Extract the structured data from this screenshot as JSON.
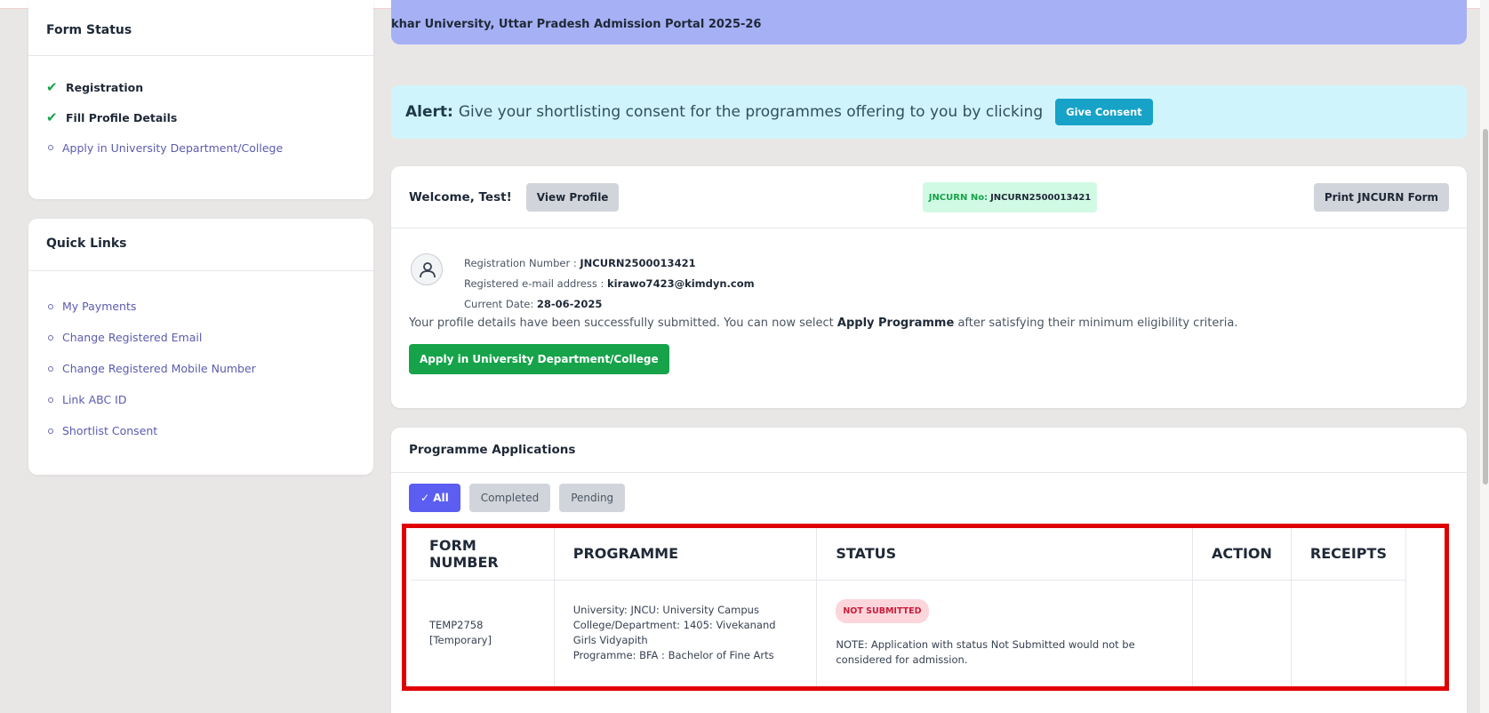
{
  "banner": {
    "text": "khar University, Uttar Pradesh Admission Portal 2025-26"
  },
  "form_status": {
    "title": "Form Status",
    "items": [
      {
        "label": "Registration",
        "state": "done"
      },
      {
        "label": "Fill Profile Details",
        "state": "done"
      },
      {
        "label": "Apply in University Department/College",
        "state": "pending"
      }
    ]
  },
  "quick_links": {
    "title": "Quick Links",
    "items": [
      {
        "label": "My Payments"
      },
      {
        "label": "Change Registered Email"
      },
      {
        "label": "Change Registered Mobile Number"
      },
      {
        "label": "Link ABC ID"
      },
      {
        "label": "Shortlist Consent"
      }
    ]
  },
  "alert": {
    "prefix": "Alert:",
    "text": "Give your shortlisting consent for the programmes offering to you by clicking",
    "button": "Give Consent"
  },
  "welcome": {
    "greeting": "Welcome, Test!",
    "view_profile": "View Profile",
    "jncurn_label": "JNCURN No:",
    "jncurn_value": "JNCURN2500013421",
    "print_button": "Print JNCURN Form",
    "reg_number_label": "Registration Number :",
    "reg_number": "JNCURN2500013421",
    "email_label": "Registered e-mail address :",
    "email": "kirawo7423@kimdyn.com",
    "date_label": "Current Date:",
    "date": "28-06-2025",
    "msg_before": "Your profile details have been successfully submitted. You can now select",
    "msg_bold": "Apply Programme",
    "msg_after": "after satisfying their minimum eligibility criteria.",
    "apply_button": "Apply in University Department/College"
  },
  "applications": {
    "title": "Programme Applications",
    "filters": [
      "All",
      "Completed",
      "Pending"
    ],
    "columns": [
      "FORM NUMBER",
      "PROGRAMME",
      "STATUS",
      "ACTION",
      "RECEIPTS"
    ],
    "rows": [
      {
        "form_number": "TEMP2758",
        "form_type": "[Temporary]",
        "university": "University: JNCU: University Campus",
        "college": "College/Department: 1405: Vivekanand Girls Vidyapith",
        "programme": "Programme: BFA : Bachelor of Fine Arts",
        "status": "NOT SUBMITTED",
        "note": "NOTE: Application with status Not Submitted would not be considered for admission.",
        "action": "",
        "receipts": ""
      }
    ]
  },
  "colors": {
    "accent": "#5b5ef0",
    "alert_bg": "#cff4fc",
    "banner_bg": "#a5b0f5",
    "success": "#16a34a",
    "highlight_border": "#e00000"
  }
}
